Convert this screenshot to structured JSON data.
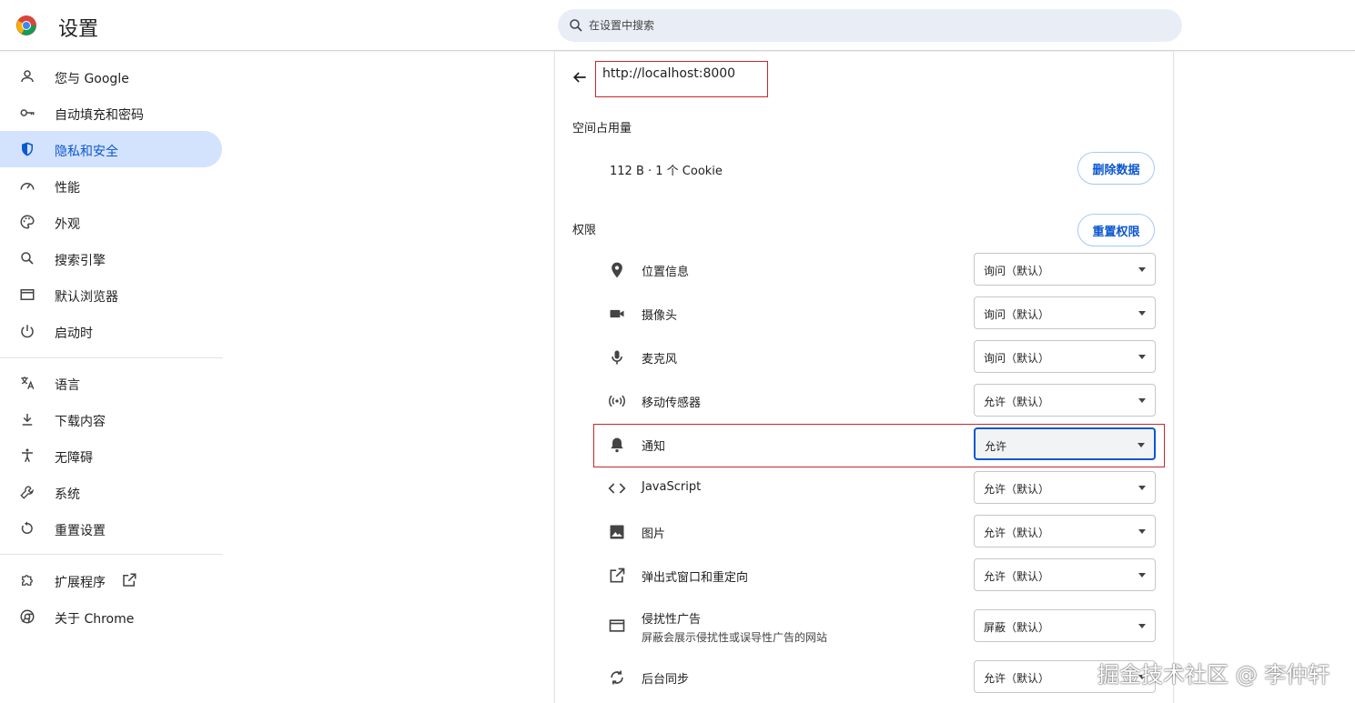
{
  "header": {
    "title": "设置",
    "search_placeholder": "在设置中搜索"
  },
  "sidebar": {
    "items": [
      {
        "label": "您与 Google",
        "icon": "person-icon"
      },
      {
        "label": "自动填充和密码",
        "icon": "key-icon"
      },
      {
        "label": "隐私和安全",
        "icon": "shield-icon",
        "active": true
      },
      {
        "label": "性能",
        "icon": "speedometer-icon"
      },
      {
        "label": "外观",
        "icon": "palette-icon"
      },
      {
        "label": "搜索引擎",
        "icon": "search-icon"
      },
      {
        "label": "默认浏览器",
        "icon": "browser-window-icon"
      },
      {
        "label": "启动时",
        "icon": "power-icon"
      },
      {
        "label": "语言",
        "icon": "translate-icon"
      },
      {
        "label": "下载内容",
        "icon": "download-icon"
      },
      {
        "label": "无障碍",
        "icon": "accessibility-icon"
      },
      {
        "label": "系统",
        "icon": "wrench-icon"
      },
      {
        "label": "重置设置",
        "icon": "reset-icon"
      },
      {
        "label": "扩展程序",
        "icon": "puzzle-icon"
      },
      {
        "label": "关于 Chrome",
        "icon": "chrome-icon"
      }
    ]
  },
  "site": {
    "url": "http://localhost:8000",
    "usage_title": "空间占用量",
    "usage_text": "112 B · 1 个 Cookie",
    "delete_label": "删除数据",
    "permissions_title": "权限",
    "reset_label": "重置权限"
  },
  "permissions": [
    {
      "label": "位置信息",
      "value": "询问（默认）",
      "icon": "location-pin-icon"
    },
    {
      "label": "摄像头",
      "value": "询问（默认）",
      "icon": "camera-icon"
    },
    {
      "label": "麦克风",
      "value": "询问（默认）",
      "icon": "microphone-icon"
    },
    {
      "label": "移动传感器",
      "value": "允许（默认）",
      "icon": "sensor-icon"
    },
    {
      "label": "通知",
      "value": "允许",
      "icon": "bell-icon"
    },
    {
      "label": "JavaScript",
      "value": "允许（默认）",
      "icon": "code-icon"
    },
    {
      "label": "图片",
      "value": "允许（默认）",
      "icon": "image-icon"
    },
    {
      "label": "弹出式窗口和重定向",
      "value": "允许（默认）",
      "icon": "open-external-icon"
    },
    {
      "label": "侵扰性广告",
      "sublabel": "屏蔽会展示侵扰性或误导性广告的网站",
      "value": "屏蔽（默认）",
      "icon": "ad-window-icon"
    },
    {
      "label": "后台同步",
      "value": "允许（默认）",
      "icon": "sync-icon"
    }
  ],
  "watermark": "掘金技术社区 @ 李仲轩",
  "colors": {
    "accent": "#0b57d0",
    "active_bg": "#d3e3fd",
    "highlight_box": "#c62828"
  }
}
